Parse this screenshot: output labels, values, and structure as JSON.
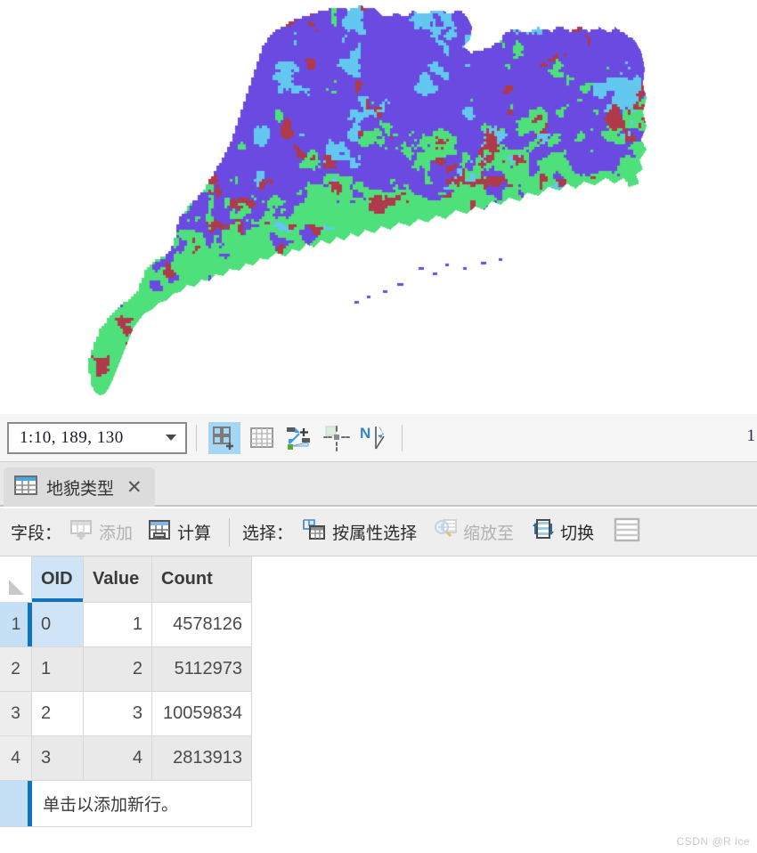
{
  "map": {
    "name": "guangdong-landform-raster",
    "legend_colors": {
      "class_1_purple": "#6a4ae0",
      "class_2_green": "#4ee07a",
      "class_3_red": "#ae3a4a",
      "class_4_lightblue": "#62c8ef",
      "background": "#ffffff"
    }
  },
  "scalebar": {
    "scale_value": "1:10, 189, 130",
    "scale_placeholder": "1:10, 189, 130",
    "right_edge_text": "1",
    "tools": [
      {
        "name": "add-layout-grid-icon",
        "label": "",
        "active": true
      },
      {
        "name": "grid-icon",
        "label": "",
        "active": false
      },
      {
        "name": "measure-icon",
        "label": "",
        "active": false
      },
      {
        "name": "snapping-icon",
        "label": "",
        "active": false
      },
      {
        "name": "north-arrow-icon",
        "label": "",
        "active": false
      }
    ]
  },
  "tabbar": {
    "tab_label": "地貌类型",
    "close_label": "✕"
  },
  "table_toolbar": {
    "fields_label": "字段：",
    "add_label": "添加",
    "calculate_label": "计算",
    "selection_label": "选择：",
    "select_by_attributes_label": "按属性选择",
    "zoom_to_label": "缩放至",
    "switch_label": "切换",
    "rows_icon_label": ""
  },
  "table": {
    "columns": [
      "OID",
      "Value",
      "Count"
    ],
    "sorted_column": "OID",
    "rows": [
      {
        "index": "1",
        "OID": "0",
        "Value": "1",
        "Count": "4578126"
      },
      {
        "index": "2",
        "OID": "1",
        "Value": "2",
        "Count": "5112973"
      },
      {
        "index": "3",
        "OID": "2",
        "Value": "3",
        "Count": "10059834"
      },
      {
        "index": "4",
        "OID": "3",
        "Value": "4",
        "Count": "2813913"
      }
    ],
    "new_row_text": "单击以添加新行。"
  },
  "watermark": {
    "text": "CSDN @R ice"
  }
}
